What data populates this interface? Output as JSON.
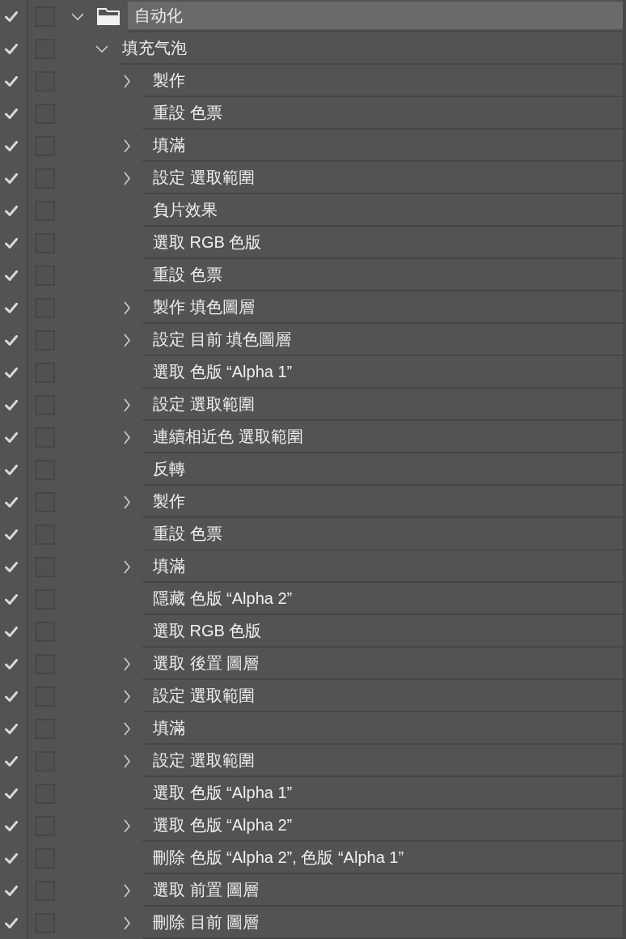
{
  "actions_panel": [
    {
      "label": "自动化",
      "enabled": true,
      "dialog": false,
      "expanded": true,
      "selected": true,
      "children": [
        {
          "label": "填充气泡",
          "enabled": true,
          "dialog": false,
          "expanded": true,
          "selected": false,
          "children": [
            {
              "label": "製作",
              "enabled": true,
              "dialog": false,
              "expandable": true,
              "selected": false
            },
            {
              "label": "重設 色票",
              "enabled": true,
              "dialog": false,
              "expandable": false,
              "selected": false
            },
            {
              "label": "填滿",
              "enabled": true,
              "dialog": false,
              "expandable": true,
              "selected": false
            },
            {
              "label": "設定 選取範圍",
              "enabled": true,
              "dialog": false,
              "expandable": true,
              "selected": false
            },
            {
              "label": "負片效果",
              "enabled": true,
              "dialog": false,
              "expandable": false,
              "selected": false
            },
            {
              "label": "選取 RGB 色版",
              "enabled": true,
              "dialog": false,
              "expandable": false,
              "selected": false
            },
            {
              "label": "重設 色票",
              "enabled": true,
              "dialog": false,
              "expandable": false,
              "selected": false
            },
            {
              "label": "製作 填色圖層",
              "enabled": true,
              "dialog": false,
              "expandable": true,
              "selected": false
            },
            {
              "label": "設定 目前 填色圖層",
              "enabled": true,
              "dialog": false,
              "expandable": true,
              "selected": false
            },
            {
              "label": "選取 色版 “Alpha 1”",
              "enabled": true,
              "dialog": false,
              "expandable": false,
              "selected": false
            },
            {
              "label": "設定 選取範圍",
              "enabled": true,
              "dialog": false,
              "expandable": true,
              "selected": false
            },
            {
              "label": "連續相近色 選取範圍",
              "enabled": true,
              "dialog": false,
              "expandable": true,
              "selected": false
            },
            {
              "label": "反轉",
              "enabled": true,
              "dialog": false,
              "expandable": false,
              "selected": false
            },
            {
              "label": "製作",
              "enabled": true,
              "dialog": false,
              "expandable": true,
              "selected": false
            },
            {
              "label": "重設 色票",
              "enabled": true,
              "dialog": false,
              "expandable": false,
              "selected": false
            },
            {
              "label": "填滿",
              "enabled": true,
              "dialog": false,
              "expandable": true,
              "selected": false
            },
            {
              "label": "隱藏 色版 “Alpha 2”",
              "enabled": true,
              "dialog": false,
              "expandable": false,
              "selected": false
            },
            {
              "label": "選取 RGB 色版",
              "enabled": true,
              "dialog": false,
              "expandable": false,
              "selected": false
            },
            {
              "label": "選取 後置 圖層",
              "enabled": true,
              "dialog": false,
              "expandable": true,
              "selected": false
            },
            {
              "label": "設定 選取範圍",
              "enabled": true,
              "dialog": false,
              "expandable": true,
              "selected": false
            },
            {
              "label": "填滿",
              "enabled": true,
              "dialog": false,
              "expandable": true,
              "selected": false
            },
            {
              "label": "設定 選取範圍",
              "enabled": true,
              "dialog": false,
              "expandable": true,
              "selected": false
            },
            {
              "label": "選取 色版 “Alpha 1”",
              "enabled": true,
              "dialog": false,
              "expandable": false,
              "selected": false
            },
            {
              "label": "選取 色版 “Alpha 2”",
              "enabled": true,
              "dialog": false,
              "expandable": true,
              "selected": false
            },
            {
              "label": "刪除 色版 “Alpha 2”, 色版 “Alpha 1”",
              "enabled": true,
              "dialog": false,
              "expandable": false,
              "selected": false
            },
            {
              "label": "選取 前置 圖層",
              "enabled": true,
              "dialog": false,
              "expandable": true,
              "selected": false
            },
            {
              "label": "刪除 目前 圖層",
              "enabled": true,
              "dialog": false,
              "expandable": true,
              "selected": false
            }
          ]
        }
      ]
    }
  ]
}
